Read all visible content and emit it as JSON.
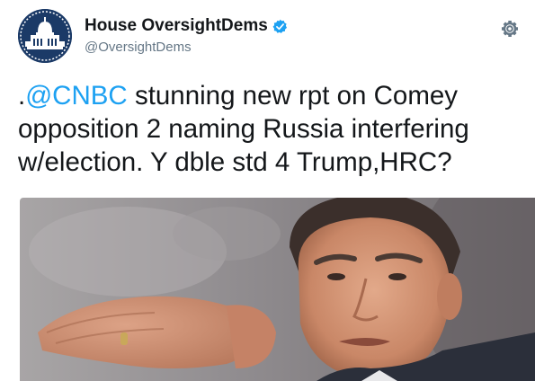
{
  "account": {
    "display_name": "House OversightDems",
    "handle": "@OversightDems",
    "verified": true,
    "avatar_icon": "capitol-dome-icon"
  },
  "header": {
    "settings_icon": "gear-icon"
  },
  "tweet": {
    "prefix": ".",
    "mention": "@CNBC",
    "line1_rest": " stunning new rpt on Comey",
    "line2": "opposition 2 naming Russia interfering",
    "line3": "w/election. Y dble std 4 Trump,HRC?"
  },
  "media": {
    "description_icon": "photo-comey-icon"
  },
  "colors": {
    "accent": "#1da1f2",
    "text": "#14171a",
    "muted": "#657786",
    "avatar_bg": "#1b3a67"
  }
}
